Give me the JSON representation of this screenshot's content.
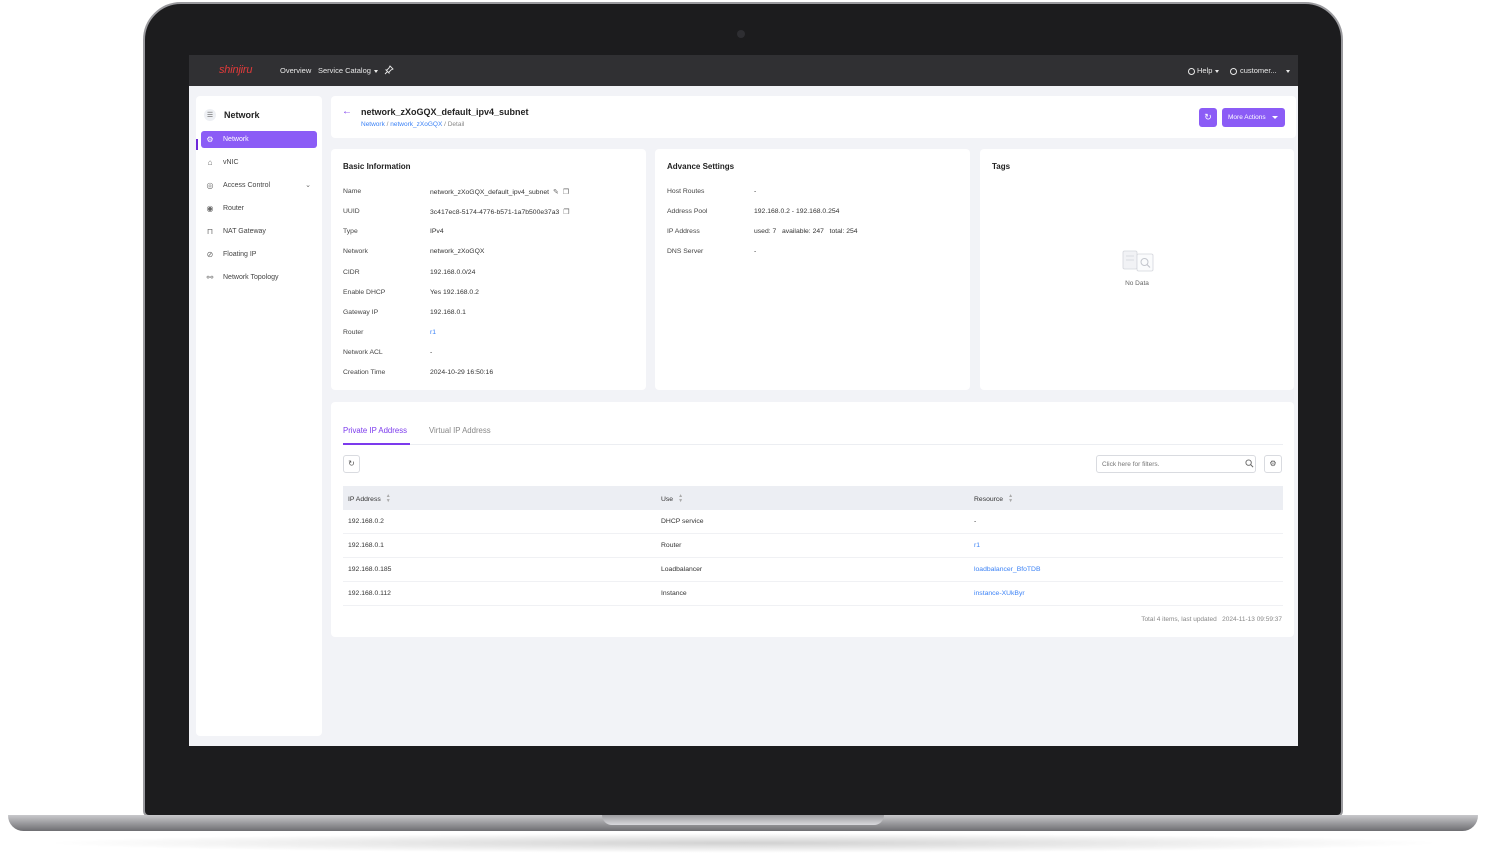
{
  "topbar": {
    "logo": "shinjiru",
    "nav": [
      "Overview",
      "Service Catalog"
    ],
    "help": "Help",
    "user": "customer..."
  },
  "sidebar": {
    "title": "Network",
    "items": [
      {
        "label": "Network",
        "icon": "gear-icon"
      },
      {
        "label": "vNIC",
        "icon": "vnic-icon"
      },
      {
        "label": "Access Control",
        "icon": "access-control-icon"
      },
      {
        "label": "Router",
        "icon": "router-icon"
      },
      {
        "label": "NAT Gateway",
        "icon": "nat-gateway-icon"
      },
      {
        "label": "Floating IP",
        "icon": "floating-ip-icon"
      },
      {
        "label": "Network Topology",
        "icon": "topology-icon"
      }
    ]
  },
  "header": {
    "title": "network_zXoGQX_default_ipv4_subnet",
    "breadcrumb": [
      "Network",
      "network_zXoGQX",
      "Detail"
    ],
    "more_actions": "More Actions"
  },
  "basic": {
    "title": "Basic Information",
    "rows": [
      {
        "k": "Name",
        "v": "network_zXoGQX_default_ipv4_subnet"
      },
      {
        "k": "UUID",
        "v": "3c417ec8-5174-4776-b571-1a7b500e37a3"
      },
      {
        "k": "Type",
        "v": "IPv4"
      },
      {
        "k": "Network",
        "v": "network_zXoGQX"
      },
      {
        "k": "CIDR",
        "v": "192.168.0.0/24"
      },
      {
        "k": "Enable DHCP",
        "v": "Yes  192.168.0.2"
      },
      {
        "k": "Gateway IP",
        "v": "192.168.0.1"
      },
      {
        "k": "Router",
        "v": "r1"
      },
      {
        "k": "Network ACL",
        "v": "-"
      },
      {
        "k": "Creation Time",
        "v": "2024-10-29 16:50:16"
      }
    ]
  },
  "advance": {
    "title": "Advance Settings",
    "rows": [
      {
        "k": "Host Routes",
        "v": "-"
      },
      {
        "k": "Address Pool",
        "v": "192.168.0.2 - 192.168.0.254"
      },
      {
        "k": "IP Address",
        "v": "used: 7   available: 247   total: 254"
      },
      {
        "k": "DNS Server",
        "v": "-"
      }
    ]
  },
  "tags": {
    "title": "Tags",
    "empty": "No Data"
  },
  "table": {
    "tabs": [
      "Private IP Address",
      "Virtual IP Address"
    ],
    "filter_placeholder": "Click here for filters.",
    "columns": [
      "IP Address",
      "Use",
      "Resource"
    ],
    "rows": [
      [
        "192.168.0.2",
        "DHCP service",
        "-"
      ],
      [
        "192.168.0.1",
        "Router",
        "r1"
      ],
      [
        "192.168.0.185",
        "Loadbalancer",
        "loadbalancer_BfoTDB"
      ],
      [
        "192.168.0.112",
        "Instance",
        "instance-XUkByr"
      ]
    ],
    "footer": "Total 4 items, last updated   2024-11-13 09:59:37"
  },
  "colors": {
    "accent": "#8b5cf6",
    "link": "#3b82f6",
    "topbar": "#303033",
    "logo": "#e03a3a"
  }
}
